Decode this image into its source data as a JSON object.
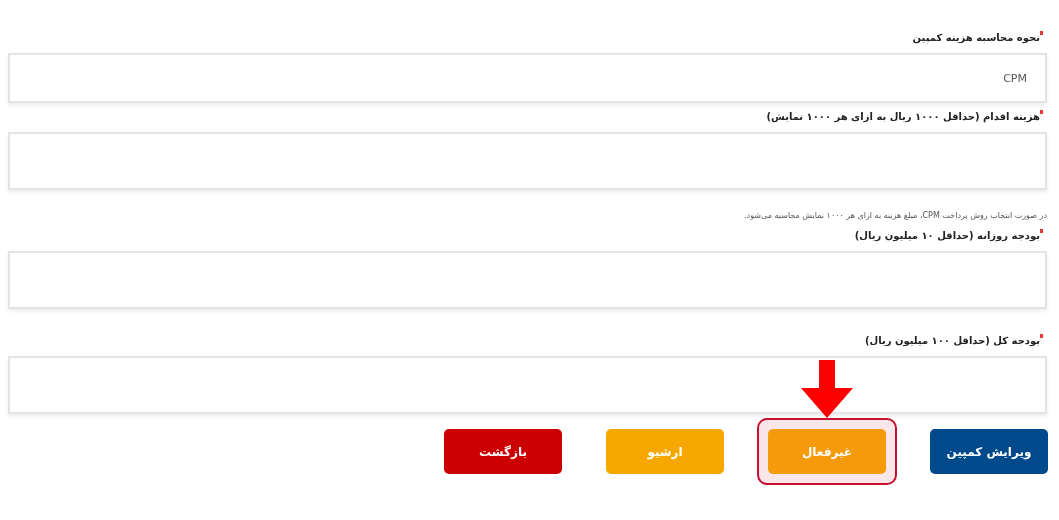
{
  "fields": [
    {
      "label": "نحوه محاسبه هزینه کمپین",
      "required": true,
      "value": "CPM"
    },
    {
      "label": "هزینه اقدام (حداقل ۱۰۰۰ ریال به ازای هر ۱۰۰۰ نمایش)",
      "required": true,
      "hint": "در صورت انتخاب روش پرداخت CPM، مبلغ هزینه به ازای هر ۱۰۰۰ نمایش محاسبه می‌شود."
    },
    {
      "label": "بودجه روزانه (حداقل ۱۰ میلیون ریال)",
      "required": true
    },
    {
      "label": "بودجه کل (حداقل ۱۰۰ میلیون ریال)",
      "required": true
    }
  ],
  "buttons": [
    {
      "label": "ویرایش کمپین",
      "color": "#004a8c",
      "highlighted": false
    },
    {
      "label": "غیرفعال",
      "color": "#f59a0a",
      "highlighted": true
    },
    {
      "label": "ارشیو",
      "color": "#f7a800",
      "highlighted": false
    },
    {
      "label": "بازگشت",
      "color": "#cc0000",
      "highlighted": false
    }
  ]
}
